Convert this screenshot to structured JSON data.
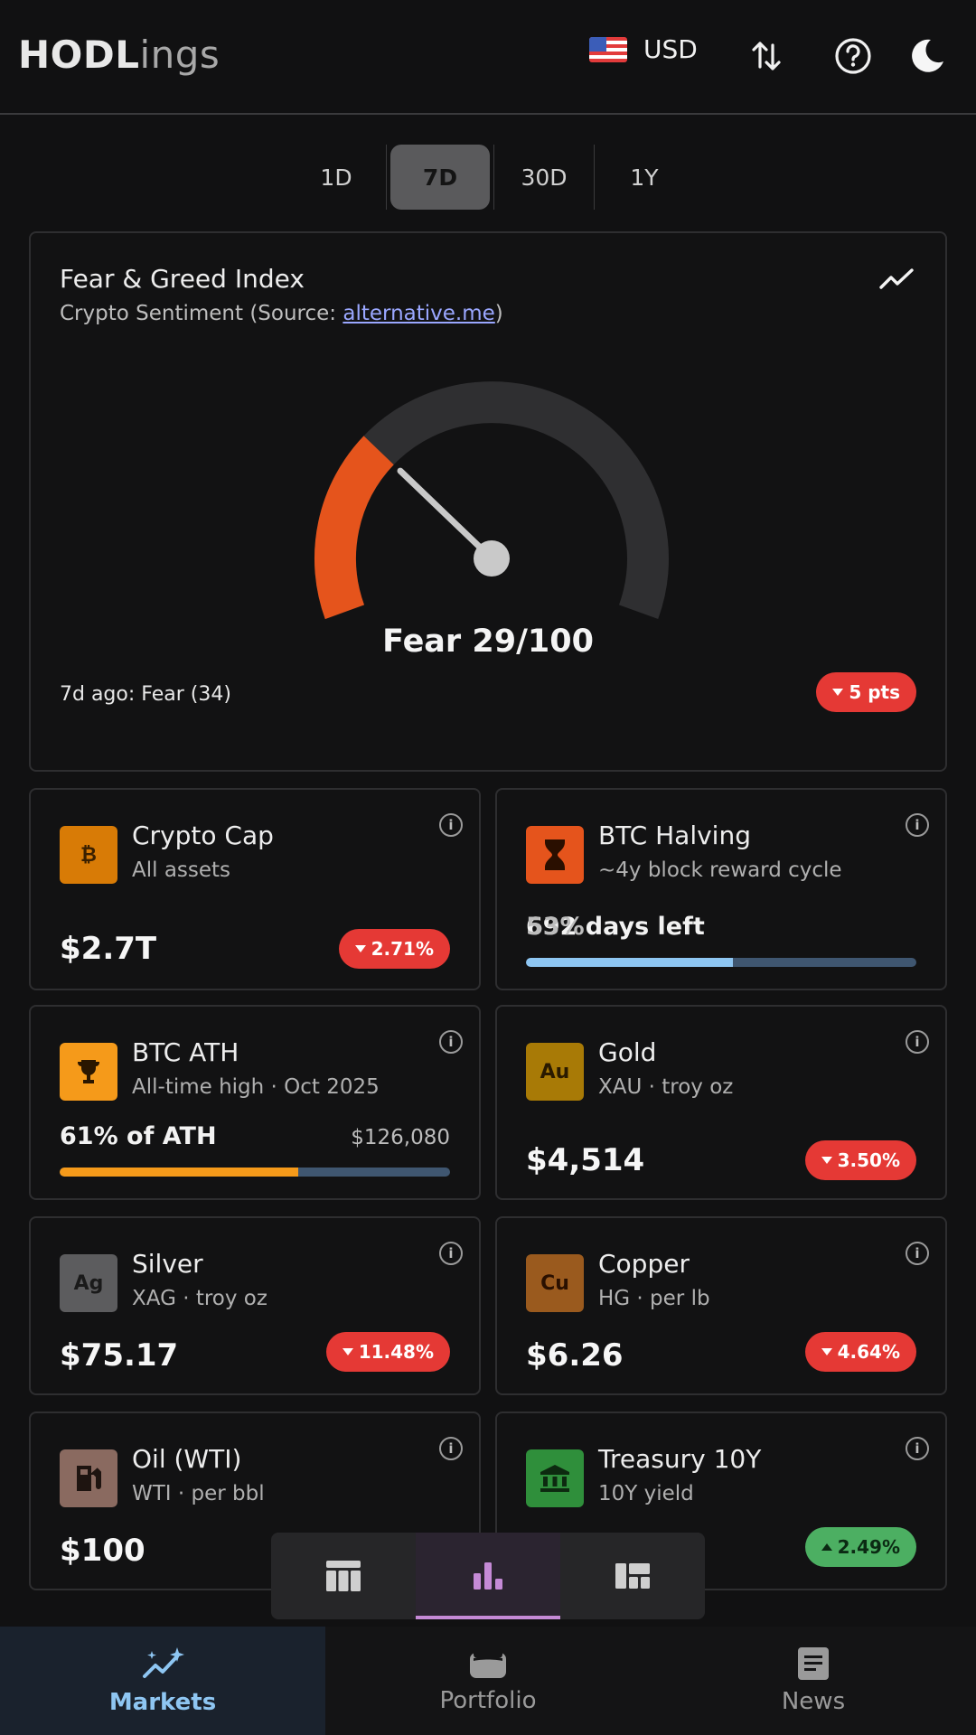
{
  "header": {
    "logo_bold": "HODL",
    "logo_light": "ings",
    "currency": "USD"
  },
  "tabs": [
    "1D",
    "7D",
    "30D",
    "1Y"
  ],
  "active_tab": "7D",
  "fear_greed": {
    "title": "Fear & Greed Index",
    "subtitle_prefix": "Crypto Sentiment (Source: ",
    "source_link": "alternative.me",
    "subtitle_suffix": ")",
    "value_label": "Fear 29/100",
    "value": 29,
    "max": 100,
    "previous": "7d ago: Fear (34)",
    "change": "5 pts",
    "colors": {
      "fill": "#e5541c",
      "track": "#2f2f31",
      "needle": "#c9c9c9"
    }
  },
  "tiles": {
    "crypto_cap": {
      "icon": "₿",
      "title": "Crypto Cap",
      "subtitle": "All assets",
      "value": "$2.7T",
      "change": "2.71%",
      "color": "#d87b06"
    },
    "btc_halving": {
      "title": "BTC Halving",
      "subtitle": "~4y block reward cycle",
      "label": "692 days left",
      "percent_label": "53%",
      "progress": 0.53,
      "color": "#e5541c",
      "bar_color": "#8ec6f2"
    },
    "btc_ath": {
      "title": "BTC ATH",
      "subtitle": "All-time high · Oct 2025",
      "label": "61% of ATH",
      "right": "$126,080",
      "progress": 0.61,
      "color": "#f59a1a",
      "bar_color": "#f59a1a"
    },
    "gold": {
      "icon": "Au",
      "title": "Gold",
      "subtitle": "XAU · troy oz",
      "value": "$4,514",
      "change": "3.50%",
      "color": "#a87a06"
    },
    "silver": {
      "icon": "Ag",
      "title": "Silver",
      "subtitle": "XAG · troy oz",
      "value": "$75.17",
      "change": "11.48%",
      "color": "#5c5c5e"
    },
    "copper": {
      "icon": "Cu",
      "title": "Copper",
      "subtitle": "HG · per lb",
      "value": "$6.26",
      "change": "4.64%",
      "color": "#9a5a1e"
    },
    "oil": {
      "title": "Oil (WTI)",
      "subtitle": "WTI · per bbl",
      "value": "$100",
      "color": "#8a6a60"
    },
    "treasury": {
      "title": "Treasury 10Y",
      "subtitle": "10Y yield",
      "change": "2.49%",
      "color": "#2f8f3b"
    }
  },
  "nav": [
    {
      "label": "Markets"
    },
    {
      "label": "Portfolio"
    },
    {
      "label": "News"
    }
  ]
}
